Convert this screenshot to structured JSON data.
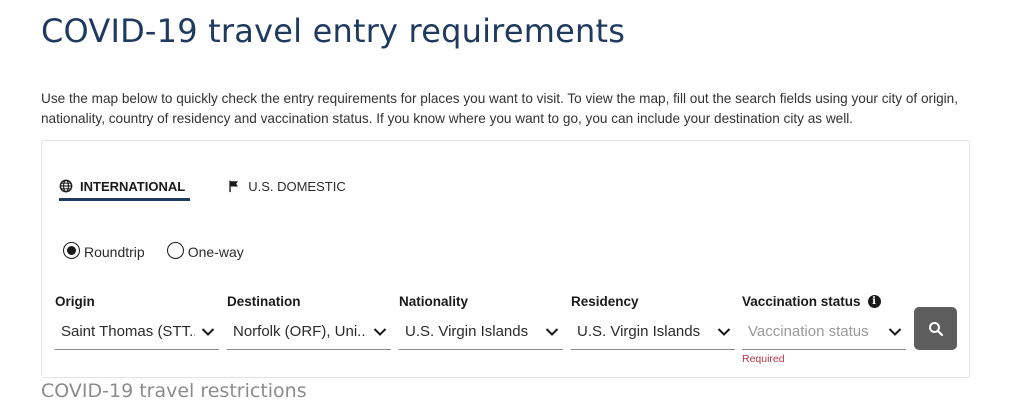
{
  "page": {
    "title": "COVID-19 travel entry requirements",
    "intro": "Use the map below to quickly check the entry requirements for places you want to visit. To view the map, fill out the search fields using your city of origin, nationality, country of residency and vaccination status. If you know where you want to go, you can include your destination city as well."
  },
  "tabs": [
    {
      "label": "INTERNATIONAL",
      "icon": "globe-icon",
      "active": true
    },
    {
      "label": "U.S. DOMESTIC",
      "icon": "flag-icon",
      "active": false
    }
  ],
  "trip_type": {
    "options": [
      {
        "label": "Roundtrip",
        "selected": true
      },
      {
        "label": "One-way",
        "selected": false
      }
    ]
  },
  "fields": {
    "origin": {
      "label": "Origin",
      "value": "Saint Thomas (STT..."
    },
    "destination": {
      "label": "Destination",
      "value": "Norfolk (ORF), Uni..."
    },
    "nationality": {
      "label": "Nationality",
      "value": "U.S. Virgin Islands"
    },
    "residency": {
      "label": "Residency",
      "value": "U.S. Virgin Islands"
    },
    "vaccination": {
      "label": "Vaccination status",
      "placeholder": "Vaccination status",
      "error": "Required"
    }
  },
  "search": {
    "icon": "search-icon"
  },
  "section": {
    "subheading": "COVID-19 travel restrictions"
  },
  "colors": {
    "title": "#1f3a5f",
    "search_button": "#5e5e5e",
    "error": "#b5364a"
  }
}
